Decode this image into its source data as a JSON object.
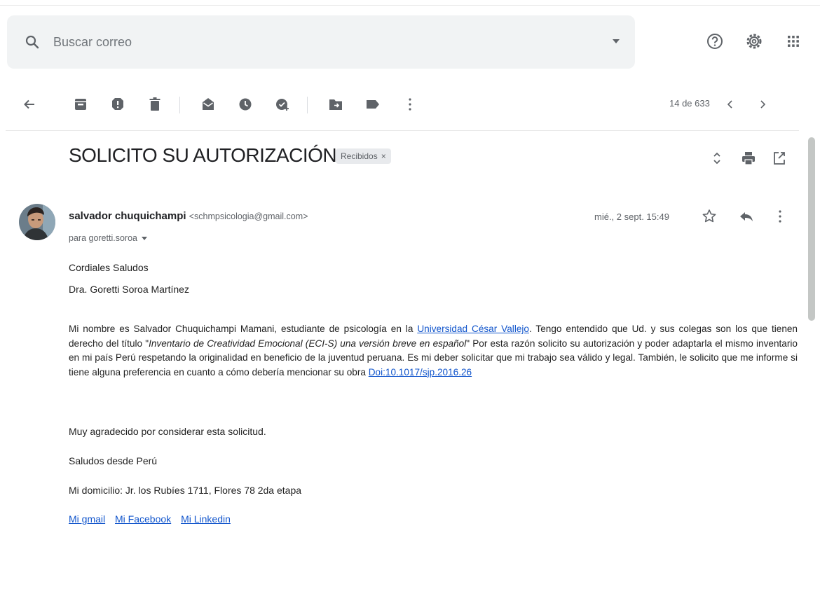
{
  "search": {
    "placeholder": "Buscar correo"
  },
  "header_icons": [
    "help-icon",
    "settings-icon",
    "apps-grid-icon"
  ],
  "toolbar": {
    "icons": [
      "back-arrow-icon",
      "archive-icon",
      "report-spam-icon",
      "delete-icon",
      "mark-unread-icon",
      "snooze-icon",
      "add-to-tasks-icon",
      "move-to-icon",
      "labels-icon",
      "more-vert-icon"
    ],
    "pagination": "14 de 633"
  },
  "email": {
    "subject": "SOLICITO SU AUTORIZACIÓN",
    "label": "Recibidos",
    "label_close": "×",
    "sender_name": "salvador chuquichampi",
    "sender_email": "<schmpsicologia@gmail.com>",
    "recipient": "para goretti.soroa",
    "date": "mié., 2 sept. 15:49",
    "greeting_1": "Cordiales Saludos",
    "greeting_2": "Dra. Goretti Soroa Martínez",
    "paragraph": {
      "p1": "Mi nombre es Salvador Chuquichampi Mamani, estudiante de psicología en la ",
      "link_university": "Universidad César Vallejo",
      "p2": ". Tengo entendido que Ud. y sus colegas son los que tienen derecho del título \"",
      "title_italic": "Inventario de Creatividad Emocional (ECI-S) una versión breve en español",
      "p3": "\" Por esta razón solicito su autorización y poder adaptarla el mismo inventario en mi país Perú respetando la originalidad en beneficio de la juventud peruana. Es mi deber solicitar que mi trabajo sea válido y legal. También, le solicito que me informe si tiene alguna preferencia en cuanto a cómo debería mencionar su obra ",
      "link_doi": "Doi:10.1017/sjp.2016.26"
    },
    "thanks": "Muy agradecido por considerar esta solicitud.",
    "regards": "Saludos desde Perú",
    "address": "Mi domicilio: Jr. los Rubíes 1711, Flores 78 2da etapa",
    "links": [
      "Mi gmail",
      "Mi Facebook",
      "Mi Linkedin"
    ]
  },
  "colors": {
    "link": "#1155cc",
    "search_bg": "#f1f3f4",
    "icon": "#5f6368"
  }
}
